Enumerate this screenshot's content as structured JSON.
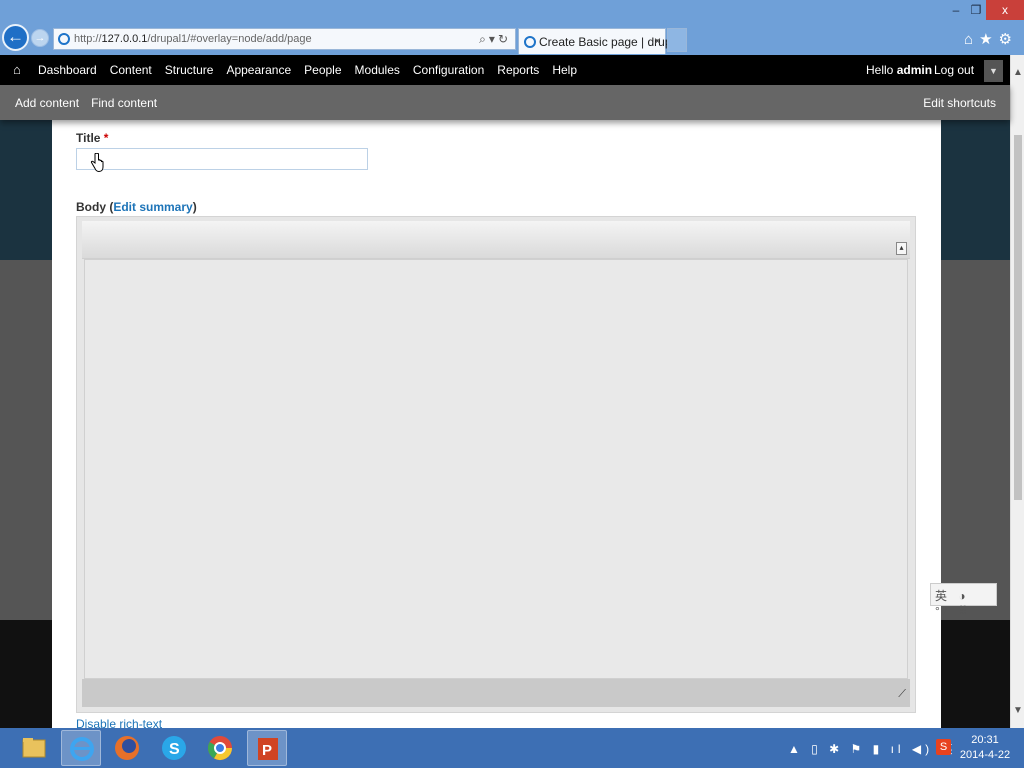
{
  "browser": {
    "url_prefix": "http://",
    "url_host": "127.0.0.1",
    "url_rest": "/drupal1/#overlay=node/add/page",
    "tab_title": "Create Basic page | drup...",
    "tab_close": "×",
    "window_controls": [
      "–",
      "❐",
      "x"
    ],
    "icons": [
      "back-arrow-icon",
      "forward-arrow-icon",
      "search-icon",
      "refresh-icon",
      "home-icon",
      "star-icon",
      "gear-icon"
    ]
  },
  "toolbar": {
    "menu": [
      "Dashboard",
      "Content",
      "Structure",
      "Appearance",
      "People",
      "Modules",
      "Configuration",
      "Reports",
      "Help"
    ],
    "greeting": "Hello ",
    "username": "admin",
    "logout": "Log out"
  },
  "shortcuts": {
    "links": [
      "Add content",
      "Find content"
    ],
    "edit": "Edit shortcuts"
  },
  "form": {
    "title_label": "Title",
    "required_mark": "*",
    "title_value": "",
    "body_label": "Body",
    "body_open": " (",
    "edit_summary": "Edit summary",
    "body_close": ")",
    "disable_rich_text": "Disable rich-text"
  },
  "ime": {
    "text": "英 ◑ °/ ⠿"
  },
  "taskbar": {
    "apps": [
      "file-explorer-icon",
      "internet-explorer-icon",
      "firefox-icon",
      "skype-icon",
      "chrome-icon",
      "powerpoint-icon"
    ],
    "tray": "▲ ▯ ✱ ⚑ ▮ ıl ◀) 英",
    "sogou": "S",
    "time": "20:31",
    "date": "2014-4-22"
  },
  "colors": {
    "chrome_blue": "#6fa0d8",
    "toolbar_black": "#000000",
    "shortcut_gray": "#666666",
    "link_blue": "#1d74b8",
    "required_red": "#cc0000",
    "taskbar_blue": "#3d6fb4"
  }
}
